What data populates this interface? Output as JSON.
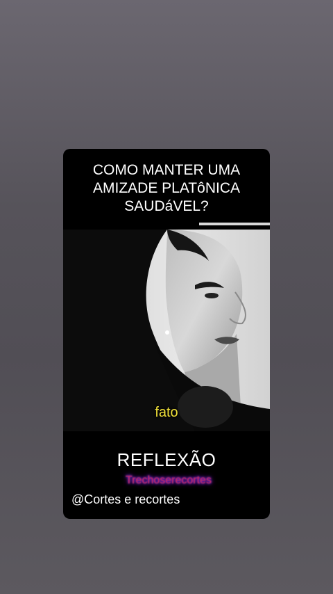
{
  "video": {
    "title_lines": [
      "COMO MANTER UMA",
      "AMIZADE PLATôNICA",
      "SAUDáVEL?"
    ],
    "progress_fraction": 0.0,
    "caption": "fato",
    "bottom_title": "REFLEXÃO",
    "watermark": "Trechoserecortes",
    "handle": "@Cortes e recortes"
  },
  "colors": {
    "caption": "#f2e23a",
    "watermark": "#c42a5b",
    "watermark_glow": "#8a2be2"
  }
}
